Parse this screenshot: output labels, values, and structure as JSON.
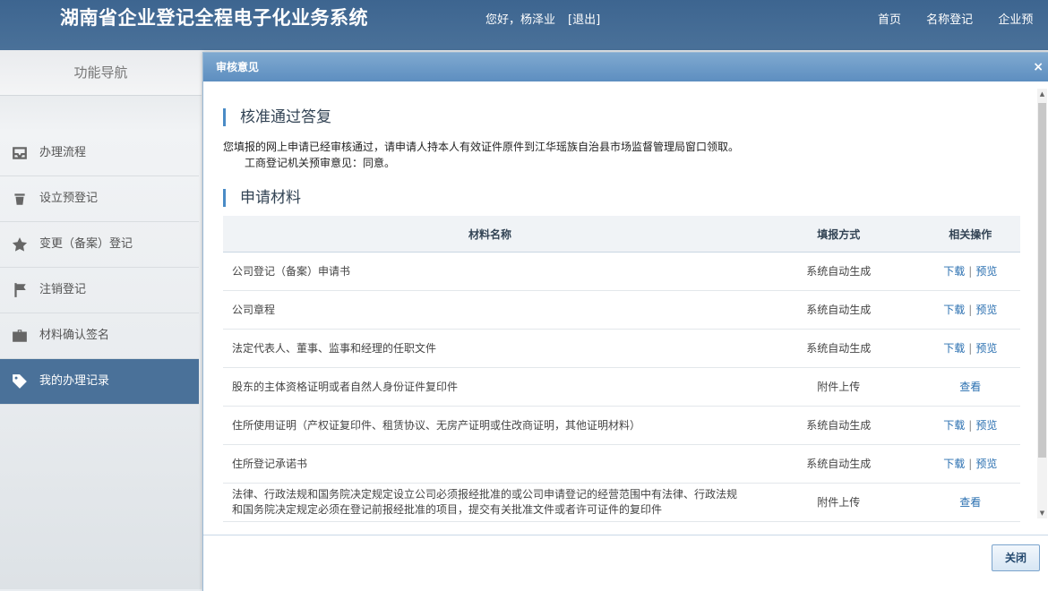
{
  "header": {
    "system_title": "湖南省企业登记全程电子化业务系统",
    "greeting": "您好，杨泽业",
    "logout_label": "[退出]",
    "nav": [
      "首页",
      "名称登记",
      "企业预"
    ]
  },
  "sidebar": {
    "title": "功能导航",
    "items": [
      {
        "label": "办理流程",
        "icon": "inbox-icon"
      },
      {
        "label": "设立预登记",
        "icon": "trash-icon"
      },
      {
        "label": "变更（备案）登记",
        "icon": "star-icon"
      },
      {
        "label": "注销登记",
        "icon": "flag-icon"
      },
      {
        "label": "材料确认签名",
        "icon": "briefcase-icon"
      },
      {
        "label": "我的办理记录",
        "icon": "tag-icon",
        "active": true
      }
    ]
  },
  "dialog": {
    "title": "审核意见",
    "close_icon": "×",
    "approval_heading": "核准通过答复",
    "approval_line1": "您填报的网上申请已经审核通过，请申请人持本人有效证件原件到江华瑶族自治县市场监督管理局窗口领取。",
    "approval_line2": "工商登记机关预审意见：同意。",
    "materials_heading": "申请材料",
    "columns": [
      "材料名称",
      "填报方式",
      "相关操作"
    ],
    "rows": [
      {
        "name": "公司登记（备案）申请书",
        "method": "系统自动生成",
        "ops": [
          "下载",
          "预览"
        ]
      },
      {
        "name": "公司章程",
        "method": "系统自动生成",
        "ops": [
          "下载",
          "预览"
        ]
      },
      {
        "name": "法定代表人、董事、监事和经理的任职文件",
        "method": "系统自动生成",
        "ops": [
          "下载",
          "预览"
        ]
      },
      {
        "name": "股东的主体资格证明或者自然人身份证件复印件",
        "method": "附件上传",
        "ops": [
          "查看"
        ]
      },
      {
        "name": "住所使用证明（产权证复印件、租赁协议、无房产证明或住改商证明，其他证明材料）",
        "method": "系统自动生成",
        "ops": [
          "下载",
          "预览"
        ]
      },
      {
        "name": "住所登记承诺书",
        "method": "系统自动生成",
        "ops": [
          "下载",
          "预览"
        ]
      },
      {
        "name": "法律、行政法规和国务院决定规定设立公司必须报经批准的或公司申请登记的经营范围中有法律、行政法规和国务院决定规定必须在登记前报经批准的项目，提交有关批准文件或者许可证件的复印件",
        "method": "附件上传",
        "ops": [
          "查看"
        ]
      }
    ],
    "close_button": "关闭"
  }
}
